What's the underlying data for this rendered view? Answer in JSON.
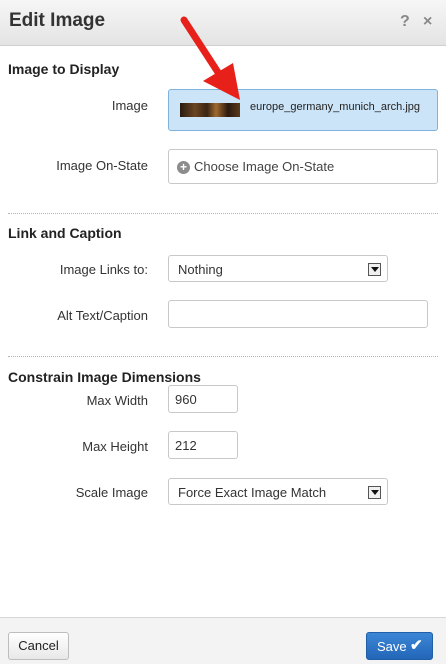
{
  "dialog": {
    "title": "Edit Image",
    "help_icon": "?",
    "close_icon": "×"
  },
  "image_section": {
    "title": "Image to Display",
    "image_label": "Image",
    "image_filename": "europe_germany_munich_arch.jpg",
    "onstate_label": "Image On-State",
    "onstate_placeholder": "Choose Image On-State"
  },
  "link_section": {
    "title": "Link and Caption",
    "links_label": "Image Links to:",
    "links_value": "Nothing",
    "alt_label": "Alt Text/Caption",
    "alt_value": ""
  },
  "dimensions_section": {
    "title": "Constrain Image Dimensions",
    "max_width_label": "Max Width",
    "max_width_value": "960",
    "max_height_label": "Max Height",
    "max_height_value": "212",
    "scale_label": "Scale Image",
    "scale_value": "Force Exact Image Match"
  },
  "footer": {
    "cancel_label": "Cancel",
    "save_label": "Save"
  },
  "colors": {
    "annotation_arrow": "#e8201a",
    "save_button": "#2d72c4",
    "selected_image_field": "#cce4f7"
  },
  "icons": [
    "help-icon",
    "close-icon",
    "image-thumbnail",
    "plus-circle-icon",
    "dropdown-arrow-icon",
    "checkmark-icon",
    "annotation-arrow"
  ]
}
